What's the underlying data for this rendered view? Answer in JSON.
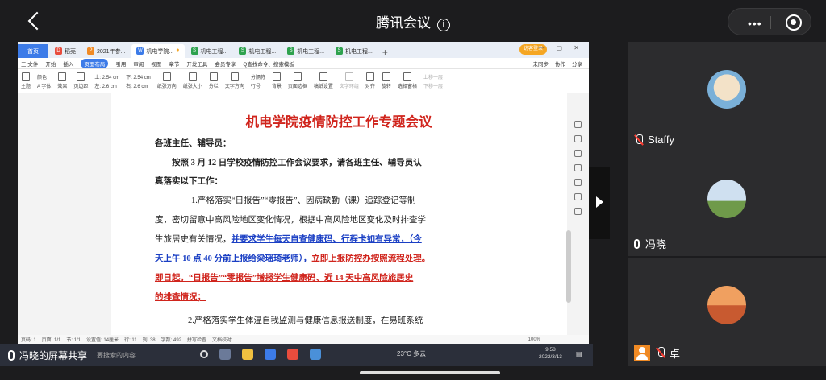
{
  "app": {
    "title": "腾讯会议"
  },
  "capsule": {
    "more": "•••"
  },
  "wps": {
    "tabs": [
      {
        "label": "首页",
        "color": "#3c7be8"
      },
      {
        "label": "稻壳",
        "icon_color": "#e84c3d"
      },
      {
        "label": "2021年参...",
        "icon_color": "#f08a24"
      },
      {
        "label": "机电学院...",
        "icon_color": "#3c7be8"
      },
      {
        "label": "机电工程...",
        "icon_color": "#2ea24e"
      },
      {
        "label": "机电工程...",
        "icon_color": "#2ea24e"
      },
      {
        "label": "机电工程...",
        "icon_color": "#2ea24e"
      },
      {
        "label": "机电工程...",
        "icon_color": "#2ea24e"
      }
    ],
    "login_label": "访客登录",
    "menus": [
      "三 文件",
      "开始",
      "插入",
      "页面布局",
      "引用",
      "审阅",
      "视图",
      "章节",
      "开发工具",
      "会员专享",
      "Q查找命令、搜索模板"
    ],
    "menu_selected": "页面布局",
    "menu_right": [
      "未同步",
      "协作",
      "分享"
    ],
    "ribbon": {
      "theme": "主题",
      "color": "颜色",
      "font": "A 字体",
      "effect": "效果",
      "margin": "页边距",
      "top": "上: 2.54 cm",
      "bottom": "下: 2.54 cm",
      "left": "左: 2.6 cm",
      "right": "右: 2.6 cm",
      "orientation": "纸张方向",
      "size": "纸张大小",
      "columns": "分栏",
      "direction": "文字方向",
      "line_num": "行号",
      "break": "分隔符",
      "background": "背景",
      "border": "页面边框",
      "manuscript": "稿纸设置",
      "wrap": "文字环绕",
      "align": "对齐",
      "rotate": "旋转",
      "selection": "选择窗格",
      "up": "上移一层",
      "down": "下移一层"
    },
    "doc": {
      "title": "机电学院疫情防控工作专题会议",
      "salutation": "各班主任、辅导员：",
      "intro_line1": "按照 3 月 12 日学校疫情防控工作会议要求，请各班主任、辅导员认",
      "intro_line2": "真落实以下工作：",
      "item1_line1": "1.严格落实“日报告”“零报告”、因病缺勤（课）追踪登记等制",
      "item1_line2": "度，密切留意中高风险地区变化情况，根据中高风险地区变化及时排查学",
      "item1_line3_plain": "生旅居史有关情况，",
      "item1_line3_blue": "并要求学生每天自查健康码、行程卡如有异常，（今",
      "item1_line4_blue": "天上午 10 点 40 分前上报给梁瑶琦老师），",
      "item1_line4_red": "立即上报防控办按照流程处理。",
      "item1_line5_red": "即日起，“日报告”“零报告”增报学生健康码、近 14 天中高风险旅居史",
      "item1_line6_red": "的排查情况；",
      "item2_line1": "2.严格落实学生体温自我监测与健康信息报送制度，在易班系统"
    },
    "status": {
      "page": "页码: 1",
      "pages": "页面: 1/1",
      "section": "节: 1/1",
      "setting": "设置值: 14厘米",
      "row": "行: 11",
      "col": "列: 38",
      "words": "字数: 492",
      "spell": "拼写检查",
      "proof": "文档校对",
      "zoom": "100%"
    }
  },
  "taskbar": {
    "share_label": "冯晓的屏幕共享",
    "search_placeholder": "要搜索的内容",
    "weather": "23°C 多云",
    "time": "9:58",
    "date": "2022/3/13"
  },
  "participants": [
    {
      "name": "Staffy",
      "mic": "muted"
    },
    {
      "name": "冯晓",
      "mic": "on"
    },
    {
      "name": "卓",
      "mic": "muted"
    }
  ]
}
